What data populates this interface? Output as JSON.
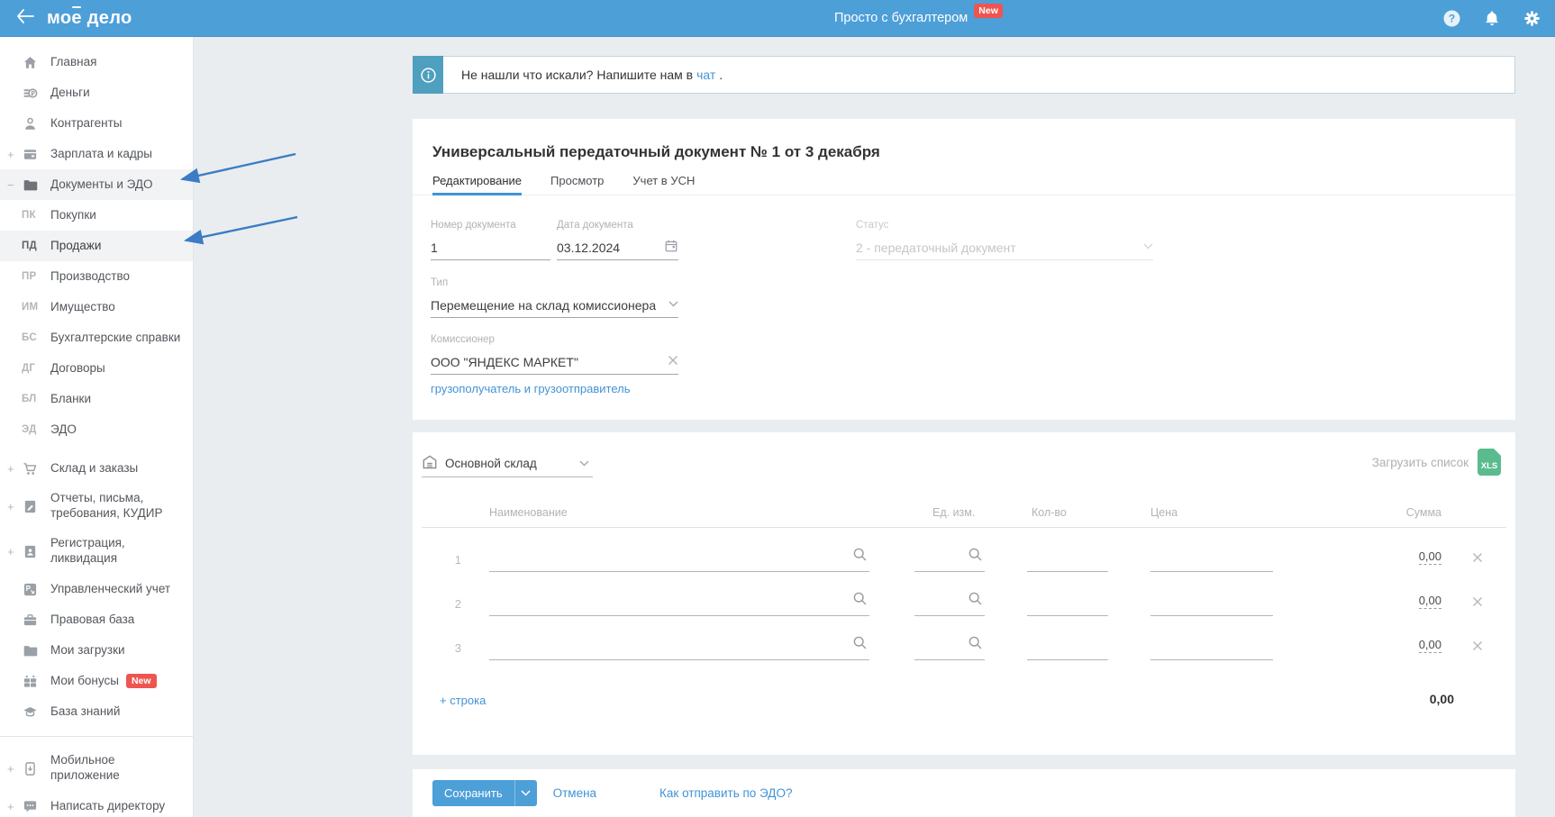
{
  "topbar": {
    "logo": {
      "part1": "мо",
      "accent": "е",
      "part2": "дело"
    },
    "promo": "Просто с бухгалтером",
    "promo_badge": "New"
  },
  "banner": {
    "text": "Не нашли что искали? Напишите нам в",
    "link": "чат",
    "suffix": "."
  },
  "sidebar": {
    "items": [
      {
        "label": "Главная"
      },
      {
        "label": "Деньги"
      },
      {
        "label": "Контрагенты"
      },
      {
        "expand": "+",
        "label": "Зарплата и кадры"
      },
      {
        "expand": "−",
        "label": "Документы и ЭДО"
      },
      {
        "prefix": "ПК",
        "label": "Покупки"
      },
      {
        "prefix": "ПД",
        "label": "Продажи"
      },
      {
        "prefix": "ПР",
        "label": "Производство"
      },
      {
        "prefix": "ИМ",
        "label": "Имущество"
      },
      {
        "prefix": "БС",
        "label": "Бухгалтерские справки"
      },
      {
        "prefix": "ДГ",
        "label": "Договоры"
      },
      {
        "prefix": "БЛ",
        "label": "Бланки"
      },
      {
        "prefix": "ЭД",
        "label": "ЭДО"
      },
      {
        "expand": "+",
        "label": "Склад и заказы"
      },
      {
        "expand": "+",
        "label": "Отчеты, письма, требования, КУДИР"
      },
      {
        "expand": "+",
        "label": "Регистрация, ликвидация"
      },
      {
        "label": "Управленческий учет"
      },
      {
        "label": "Правовая база"
      },
      {
        "label": "Мои загрузки"
      },
      {
        "label": "Мои бонусы",
        "badge": "New"
      },
      {
        "label": "База знаний"
      },
      {
        "expand": "+",
        "label": "Мобильное приложение"
      },
      {
        "expand": "+",
        "label": "Написать директору"
      }
    ]
  },
  "document": {
    "title": "Универсальный передаточный документ № 1 от 3 декабря",
    "tabs": [
      "Редактирование",
      "Просмотр",
      "Учет в УСН"
    ],
    "fields": {
      "number": {
        "label": "Номер документа",
        "value": "1"
      },
      "date": {
        "label": "Дата документа",
        "value": "03.12.2024"
      },
      "status": {
        "label": "Статус",
        "value": "2 - передаточный документ"
      },
      "type": {
        "label": "Тип",
        "value": "Перемещение на склад комиссионера"
      },
      "commissioner": {
        "label": "Комиссионер",
        "value": "ООО \"ЯНДЕКС МАРКЕТ\""
      }
    },
    "cargo_link": "грузополучатель и грузоотправитель"
  },
  "items_section": {
    "warehouse": {
      "value": "Основной склад"
    },
    "upload": {
      "label": "Загрузить список",
      "icon_text": "XLS"
    },
    "table": {
      "headers": [
        "Наименование",
        "Ед. изм.",
        "Кол-во",
        "Цена",
        "Сумма"
      ],
      "rows": [
        {
          "num": "1",
          "sum": "0,00"
        },
        {
          "num": "2",
          "sum": "0,00"
        },
        {
          "num": "3",
          "sum": "0,00"
        }
      ],
      "add_row": "+ строка",
      "total": "0,00"
    }
  },
  "footer": {
    "save": "Сохранить",
    "cancel": "Отмена",
    "edo_link": "Как отправить по ЭДО?"
  },
  "colors": {
    "topbar": "#4d9fd8",
    "accent_link": "#4193d6",
    "badge_red": "#ee5550",
    "banner_teal": "#4f9fbe",
    "xls_green": "#5abb8f"
  }
}
